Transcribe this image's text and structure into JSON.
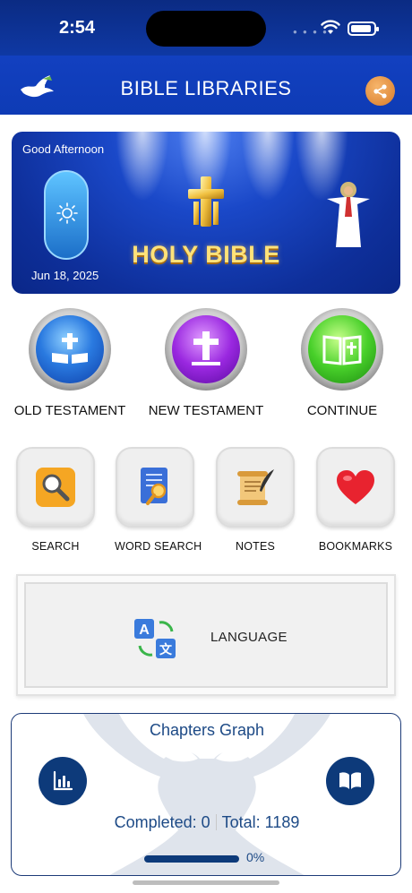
{
  "status_bar": {
    "time": "2:54"
  },
  "header": {
    "title": "BIBLE LIBRARIES"
  },
  "banner": {
    "greeting": "Good Afternoon",
    "date": "Jun 18, 2025",
    "logo_text": "HOLY BIBLE"
  },
  "main_buttons": [
    {
      "label": "OLD TESTAMENT",
      "icon": "open-bible-cross-icon"
    },
    {
      "label": "NEW TESTAMENT",
      "icon": "cross-icon"
    },
    {
      "label": "CONTINUE",
      "icon": "book-icon"
    }
  ],
  "tools": [
    {
      "label": "SEARCH",
      "icon": "magnifier-icon"
    },
    {
      "label": "WORD SEARCH",
      "icon": "document-search-icon"
    },
    {
      "label": "NOTES",
      "icon": "scroll-quill-icon"
    },
    {
      "label": "BOOKMARKS",
      "icon": "heart-icon"
    }
  ],
  "language": {
    "label": "LANGUAGE",
    "icon": "translate-icon"
  },
  "chapters_graph": {
    "title": "Chapters Graph",
    "completed_label": "Completed: 0",
    "total_label": "Total: 1189",
    "progress_percent": 0,
    "progress_text": "0%"
  },
  "colors": {
    "header_blue": "#0f3aa8",
    "accent_navy": "#0d3a7a",
    "share_orange": "#e0893a"
  }
}
